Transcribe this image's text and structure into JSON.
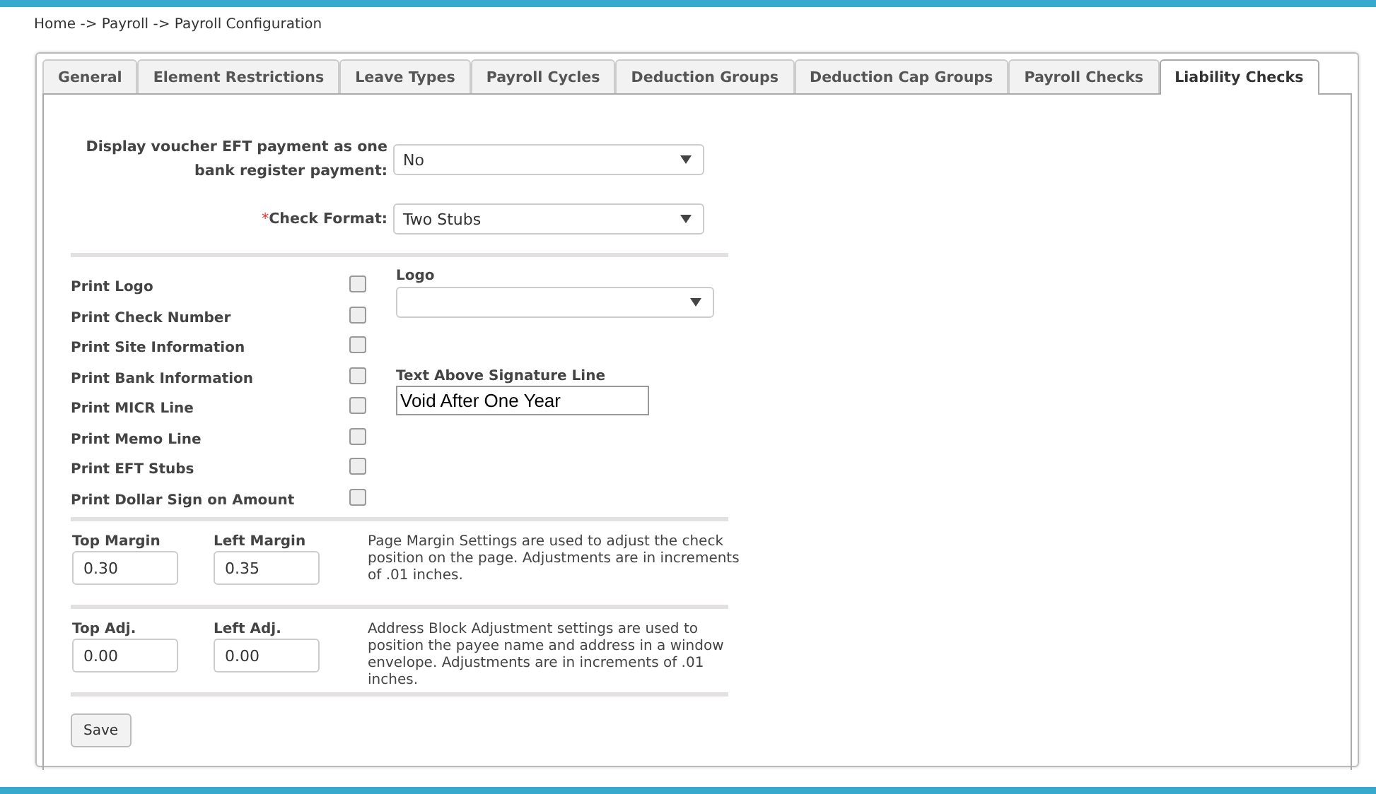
{
  "breadcrumb": "Home -> Payroll -> Payroll Configuration",
  "tabs": [
    {
      "label": "General",
      "selected": false
    },
    {
      "label": "Element Restrictions",
      "selected": false
    },
    {
      "label": "Leave Types",
      "selected": false
    },
    {
      "label": "Payroll Cycles",
      "selected": false
    },
    {
      "label": "Deduction Groups",
      "selected": false
    },
    {
      "label": "Deduction Cap Groups",
      "selected": false
    },
    {
      "label": "Payroll Checks",
      "selected": false
    },
    {
      "label": "Liability Checks",
      "selected": true
    }
  ],
  "settings": [
    {
      "label": "Display voucher EFT payment as one bank register payment:",
      "value": "No"
    },
    {
      "label": "Check Format:",
      "value": "Two Stubs",
      "required_mark": "*"
    }
  ],
  "print_options": [
    {
      "label": "Print Logo",
      "checked": false
    },
    {
      "label": "Print Check Number",
      "checked": false
    },
    {
      "label": "Print Site Information",
      "checked": false
    },
    {
      "label": "Print Bank Information",
      "checked": false
    },
    {
      "label": "Print MICR Line",
      "checked": false
    },
    {
      "label": "Print Memo Line",
      "checked": false
    },
    {
      "label": "Print EFT Stubs",
      "checked": false
    },
    {
      "label": "Print Dollar Sign on Amount",
      "checked": false
    }
  ],
  "logo": {
    "label": "Logo"
  },
  "signature": {
    "label": "Text Above Signature Line",
    "value": "Void After One Year"
  },
  "adjustment_groups": [
    {
      "fields": [
        {
          "label": "Top Margin",
          "value": "0.30"
        },
        {
          "label": "Left Margin",
          "value": "0.35"
        }
      ],
      "note": "Page Margin Settings are used to adjust the check position on the page. Adjustments are in increments of .01 inches."
    },
    {
      "fields": [
        {
          "label": "Top Adj.",
          "value": "0.00"
        },
        {
          "label": "Left Adj.",
          "value": "0.00"
        }
      ],
      "note": "Address Block Adjustment settings are used to position the payee name and address in a window envelope. Adjustments are in increments of .01 inches."
    }
  ],
  "save_button": "Save"
}
